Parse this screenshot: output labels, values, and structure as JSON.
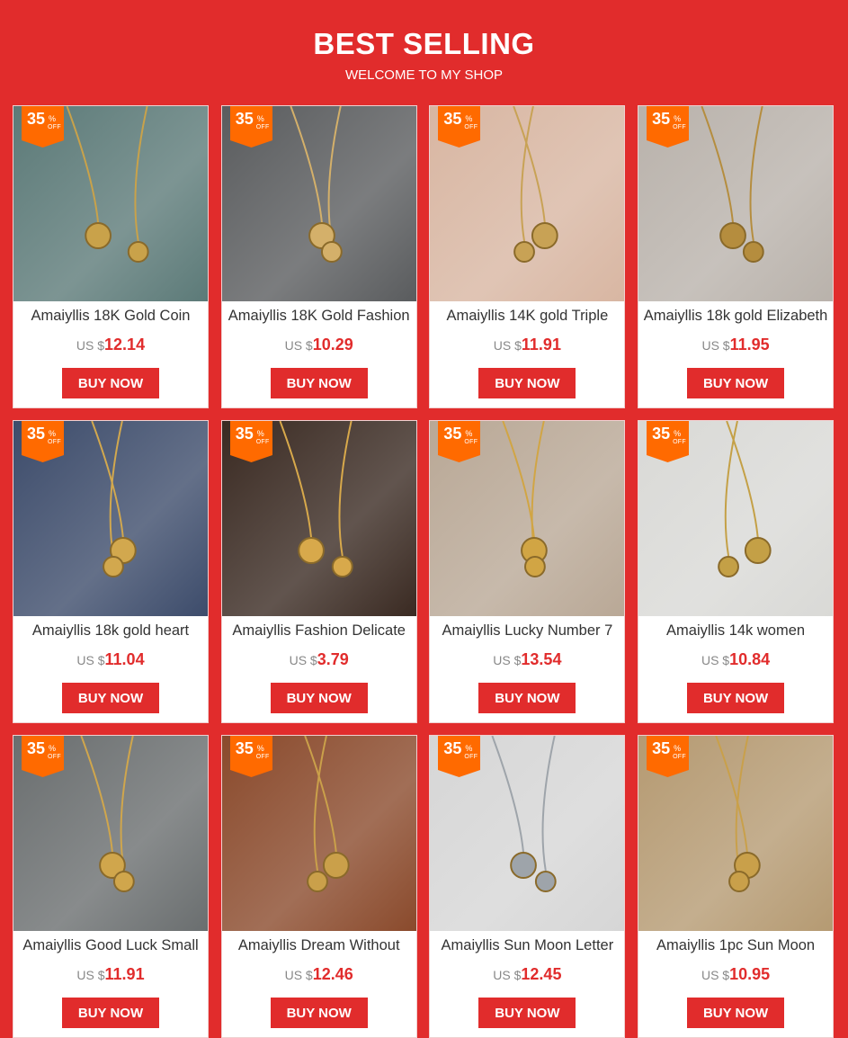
{
  "header": {
    "title": "BEST SELLING",
    "subtitle": "WELCOME TO MY SHOP"
  },
  "colors": {
    "brand_red": "#e12c2c",
    "badge_orange": "#ff6a00"
  },
  "badge": {
    "percent": "35",
    "symbol": "%",
    "off": "OFF"
  },
  "products": [
    {
      "name": "Amaiyllis 18K Gold Coin",
      "currency": "US $",
      "price": "12.14",
      "button": "BUY NOW",
      "bg": "#5c7a78",
      "accent": "#c9a24a"
    },
    {
      "name": "Amaiyllis 18K Gold Fashion",
      "currency": "US $",
      "price": "10.29",
      "button": "BUY NOW",
      "bg": "#5a5c5e",
      "accent": "#d4b06a"
    },
    {
      "name": "Amaiyllis 14K gold Triple",
      "currency": "US $",
      "price": "11.91",
      "button": "BUY NOW",
      "bg": "#d8b6a2",
      "accent": "#c8a255"
    },
    {
      "name": "Amaiyllis 18k gold Elizabeth",
      "currency": "US $",
      "price": "11.95",
      "button": "BUY NOW",
      "bg": "#b9b2ab",
      "accent": "#b58d3e"
    },
    {
      "name": "Amaiyllis 18k gold heart",
      "currency": "US $",
      "price": "11.04",
      "button": "BUY NOW",
      "bg": "#3d4c6b",
      "accent": "#d2a84e"
    },
    {
      "name": "Amaiyllis Fashion Delicate",
      "currency": "US $",
      "price": "3.79",
      "button": "BUY NOW",
      "bg": "#3a2a22",
      "accent": "#d8a94b"
    },
    {
      "name": "Amaiyllis Lucky Number 7",
      "currency": "US $",
      "price": "13.54",
      "button": "BUY NOW",
      "bg": "#b9a896",
      "accent": "#d1a544"
    },
    {
      "name": "Amaiyllis 14k women",
      "currency": "US $",
      "price": "10.84",
      "button": "BUY NOW",
      "bg": "#d9d9d6",
      "accent": "#c4a046"
    },
    {
      "name": "Amaiyllis Good Luck Small",
      "currency": "US $",
      "price": "11.91",
      "button": "BUY NOW",
      "bg": "#6a6e6f",
      "accent": "#d0a64c"
    },
    {
      "name": "Amaiyllis Dream Without",
      "currency": "US $",
      "price": "12.46",
      "button": "BUY NOW",
      "bg": "#8a4a2c",
      "accent": "#caa04a"
    },
    {
      "name": "Amaiyllis Sun Moon Letter",
      "currency": "US $",
      "price": "12.45",
      "button": "BUY NOW",
      "bg": "#d6d6d6",
      "accent": "#9ea4aa"
    },
    {
      "name": "Amaiyllis 1pc Sun Moon",
      "currency": "US $",
      "price": "10.95",
      "button": "BUY NOW",
      "bg": "#b59a72",
      "accent": "#c9a04a"
    }
  ]
}
